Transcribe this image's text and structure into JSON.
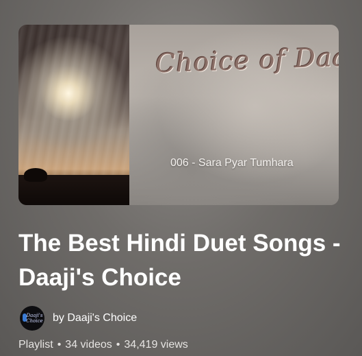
{
  "thumbnail": {
    "title_text": "Choice of Daaji",
    "track_text": "006 - Sara Pyar Tumhara"
  },
  "playlist": {
    "title": "The Best Hindi Duet Songs - Daaji's Choice",
    "channel": "by Daaji's Choice",
    "avatar_text": "Daaji's Choice",
    "type": "Playlist",
    "video_count": "34 videos",
    "views": "34,419 views",
    "separator": "•"
  },
  "colors": {
    "avatar_accent": "#3a7bd5",
    "title_text": "#ffffff"
  }
}
